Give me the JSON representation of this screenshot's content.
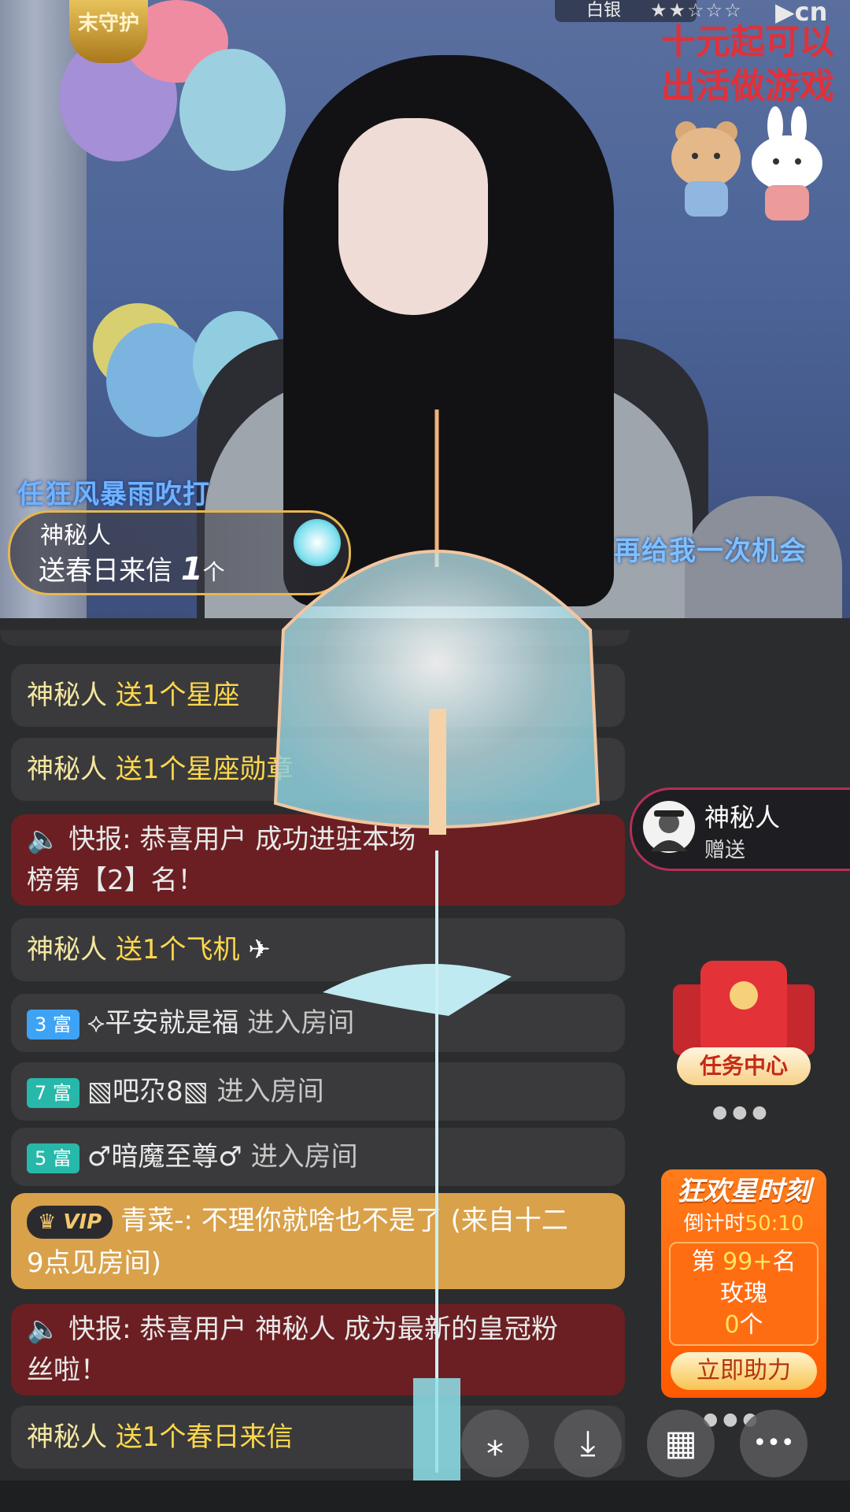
{
  "stream": {
    "guard_badge": "末守护",
    "rank_badge": "白银",
    "stars": "★★☆☆☆",
    "site_suffix": "cn",
    "promo_line1": "十元起可以",
    "promo_line2": "出活做游戏",
    "lyric_left": "任狂风暴雨吹打",
    "lyric_right": "再给我一次机会"
  },
  "gift_banner": {
    "user": "神秘人",
    "prefix": "送",
    "gift": "春日来信",
    "count": "1",
    "unit": "个"
  },
  "chat": [
    {
      "type": "gift",
      "user": "神秘人",
      "text": "送1个星座"
    },
    {
      "type": "gift",
      "user": "神秘人",
      "text": "送1个星座勋章"
    },
    {
      "type": "announce",
      "line1": "快报: 恭喜用户",
      "line1b": "成功进驻本场",
      "line2": "榜第【2】名！"
    },
    {
      "type": "gift",
      "user": "神秘人",
      "text": "送1个飞机"
    },
    {
      "type": "enter",
      "level": "3 富",
      "user": "⟡平安就是福",
      "text": "进入房间"
    },
    {
      "type": "enter",
      "level": "7 富",
      "user": "▧吧尕8▧",
      "text": "进入房间"
    },
    {
      "type": "enter",
      "level": "5 富",
      "user": "♂暗魔至尊♂",
      "text": "进入房间"
    },
    {
      "type": "vip",
      "badge": "VIP",
      "line1": "青菜-: 不理你就啥也不是了 (来自十二",
      "line2": "9点见房间)"
    },
    {
      "type": "announce2",
      "line1": "快报: 恭喜用户 神秘人 成为最新的皇冠粉",
      "line2": "丝啦！"
    },
    {
      "type": "gift",
      "user": "神秘人",
      "text": "送1个春日来信"
    }
  ],
  "gift_notice": {
    "user": "神秘人",
    "action": "赠送"
  },
  "task_center": {
    "label": "任务中心",
    "dots": "●●●"
  },
  "event": {
    "title": "狂欢星时刻",
    "countdown_label": "倒计时",
    "countdown": "50:10",
    "rank_prefix": "第",
    "rank": "99+",
    "rank_suffix": "名",
    "item": "玫瑰",
    "amount": "0",
    "unit": "个",
    "button": "立即助力",
    "dots": "●●●"
  },
  "toolbar": {
    "effects": "⁎",
    "download": "⤓",
    "grid": "▦",
    "more": "•••"
  }
}
